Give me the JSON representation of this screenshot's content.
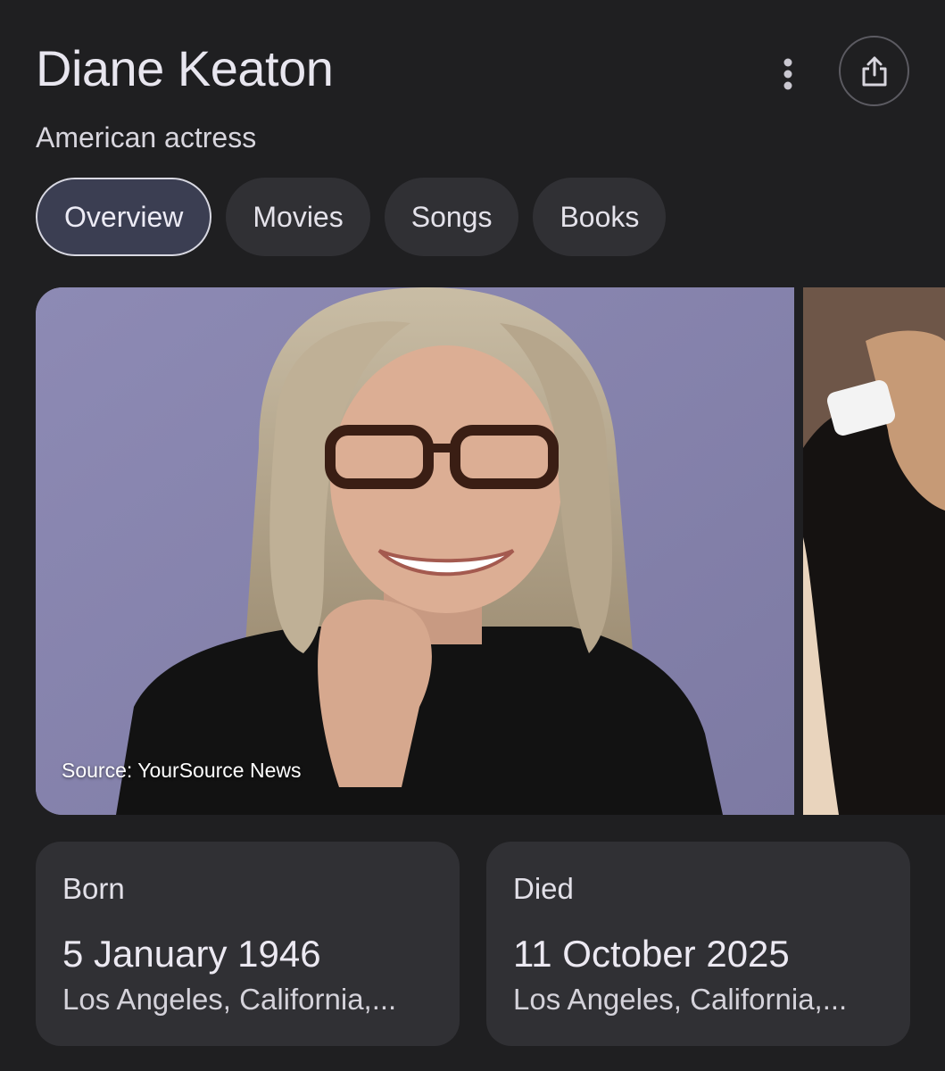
{
  "header": {
    "title": "Diane Keaton",
    "subtitle": "American actress"
  },
  "icons": {
    "more": "more-vert-icon",
    "share": "share-icon"
  },
  "tabs": [
    {
      "label": "Overview",
      "active": true
    },
    {
      "label": "Movies",
      "active": false
    },
    {
      "label": "Songs",
      "active": false
    },
    {
      "label": "Books",
      "active": false
    }
  ],
  "images": {
    "main_source": "Source: YourSource News"
  },
  "facts": {
    "born": {
      "label": "Born",
      "date": "5 January 1946",
      "place": "Los Angeles, California,..."
    },
    "died": {
      "label": "Died",
      "date": "11 October 2025",
      "place": "Los Angeles, California,..."
    }
  }
}
